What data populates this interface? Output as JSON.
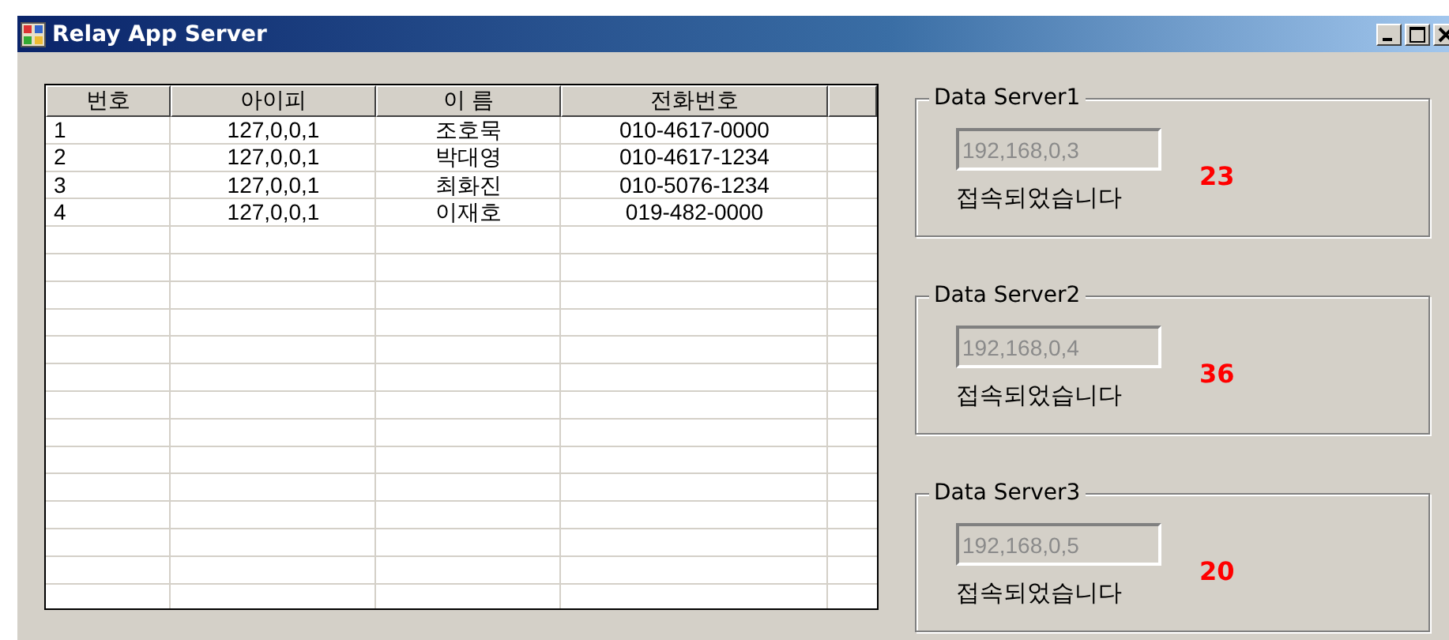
{
  "window": {
    "title": "Relay App Server"
  },
  "table": {
    "columns": [
      "번호",
      "아이피",
      "이 름",
      "전화번호"
    ],
    "rows": [
      [
        "1",
        "127,0,0,1",
        "조호묵",
        "010-4617-0000"
      ],
      [
        "2",
        "127,0,0,1",
        "박대영",
        "010-4617-1234"
      ],
      [
        "3",
        "127,0,0,1",
        "최화진",
        "010-5076-1234"
      ],
      [
        "4",
        "127,0,0,1",
        "이재호",
        "019-482-0000"
      ]
    ]
  },
  "servers": [
    {
      "title": "Data Server1",
      "address": "192,168,0,3",
      "disabled": true,
      "status": "접속되었습니다",
      "count": "23"
    },
    {
      "title": "Data Server2",
      "address": "192,168,0,4",
      "disabled": true,
      "status": "접속되었습니다",
      "count": "36"
    },
    {
      "title": "Data Server3",
      "address": "192,168,0,5",
      "disabled": true,
      "status": "접속되었습니다",
      "count": "20"
    }
  ]
}
